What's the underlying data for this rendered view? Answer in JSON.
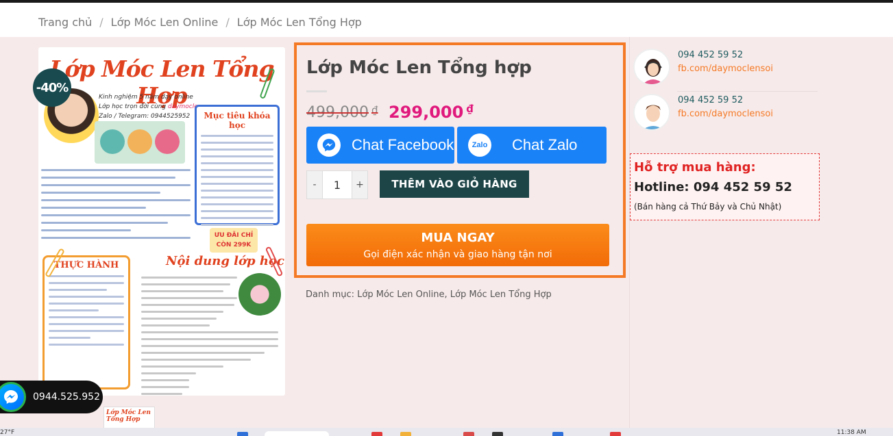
{
  "breadcrumb": {
    "items": [
      "Trang chủ",
      "Lớp Móc Len Online",
      "Lớp Móc Len Tổng Hợp"
    ],
    "separator": "/"
  },
  "product_image": {
    "poster_title": "Lớp Móc Len Tổng Hợp",
    "poster_subtitle": "Kinh nghiệm 5 năm dạy online",
    "poster_line2_a": "Lớp học trọn đời cùng ",
    "poster_line2_b": "daymoclen",
    "poster_line3": "Zalo / Telegram: 0944525952",
    "goal_panel_title": "Mục tiêu khóa học",
    "deal_line1": "ƯU ĐÃI CHỈ",
    "deal_line2": "CÒN 299K",
    "practice_title": "THỰC HÀNH",
    "content_title": "Nội dung lớp học",
    "thumb_title": "Lớp Móc Len Tổng Hợp"
  },
  "sale_badge": "-40%",
  "floating_contact": {
    "phone": "0944.525.952",
    "icon": "messenger-icon"
  },
  "product": {
    "title": "Lớp Móc Len Tổng hợp",
    "old_price": "499,000",
    "new_price": "299,000",
    "currency": "₫",
    "chat_facebook": "Chat Facebook",
    "chat_zalo": "Chat Zalo",
    "zalo_icon_text": "Zalo",
    "qty_minus": "-",
    "qty_value": "1",
    "qty_plus": "+",
    "add_to_cart": "THÊM VÀO GIỎ HÀNG",
    "buy_now_title": "MUA NGAY",
    "buy_now_sub": "Gọi điện xác nhận và giao hàng tận nơi",
    "category_label": "Danh mục:",
    "categories": [
      "Lớp Móc Len Online",
      "Lớp Móc Len Tổng Hợp"
    ]
  },
  "sidebar": {
    "contacts": [
      {
        "phone": "094 452 59 52",
        "fb": "fb.com/daymoclensoi"
      },
      {
        "phone": "094 452 59 52",
        "fb": "fb.com/daymoclensoi"
      }
    ],
    "support_title": "Hỗ trợ mua hàng:",
    "hotline": "Hotline: 094 452 59 52",
    "note": "(Bán hàng cả Thứ Bảy và Chủ Nhật)"
  },
  "taskbar": {
    "left_text": "27°F",
    "time": "11:38 AM"
  },
  "colors": {
    "accent_orange": "#f47a26",
    "price_pink": "#e0197d",
    "dark_teal": "#1d4548",
    "chat_blue": "#1a82f7",
    "support_red": "#e02323"
  }
}
